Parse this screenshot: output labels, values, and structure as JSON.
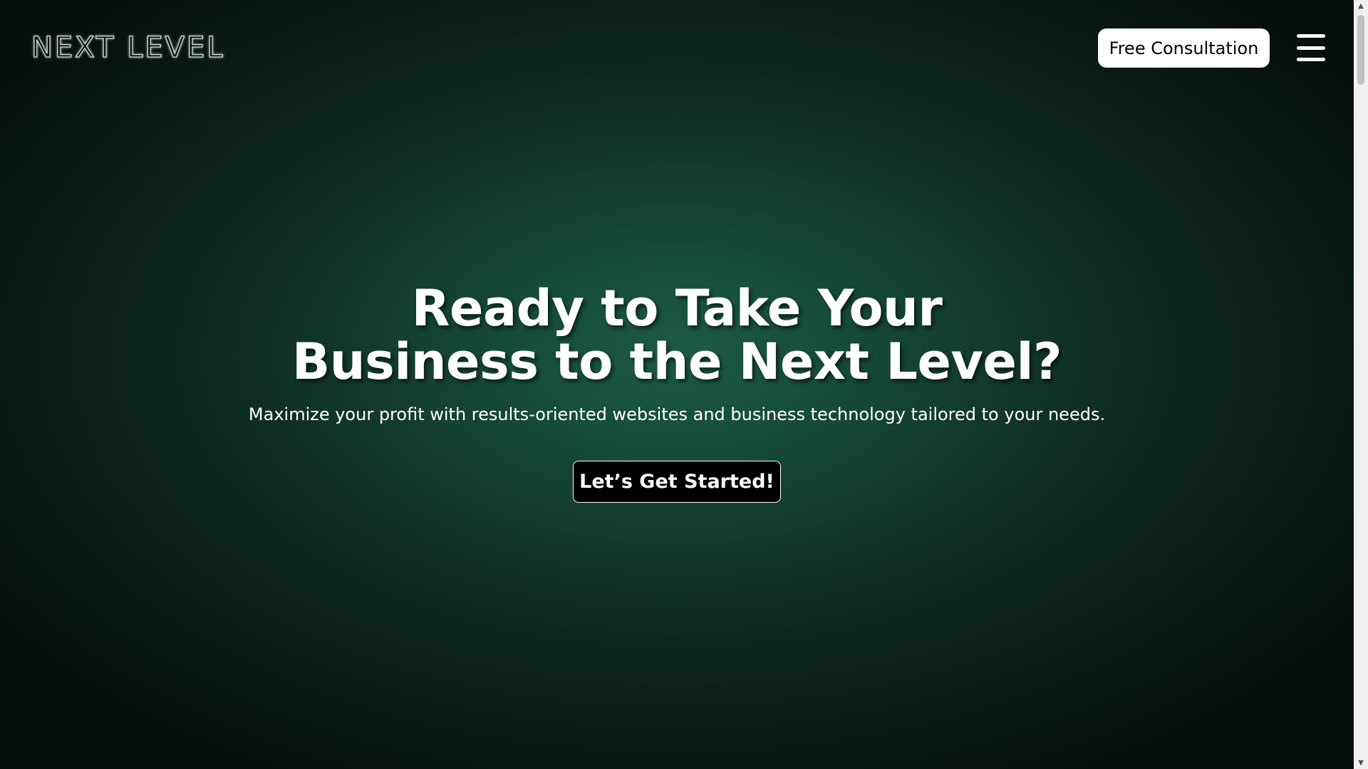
{
  "header": {
    "logo_text": "NEXT LEVEL",
    "cta_label": "Free Consultation",
    "menu_icon": "hamburger-menu-icon"
  },
  "hero": {
    "title_line1": "Ready to Take Your",
    "title_line2": "Business to the Next Level?",
    "subtitle": "Maximize your profit with results-oriented websites and business technology tailored to your needs.",
    "cta_label": "Let’s Get Started!"
  },
  "scrollbar": {
    "up_icon": "scroll-up-arrow-icon",
    "down_icon": "scroll-down-arrow-icon"
  },
  "colors": {
    "background_center": "#1d5a46",
    "background_edge": "#070f0c",
    "primary_button_bg": "#ffffff",
    "secondary_button_bg": "#000000",
    "text": "#ffffff"
  }
}
